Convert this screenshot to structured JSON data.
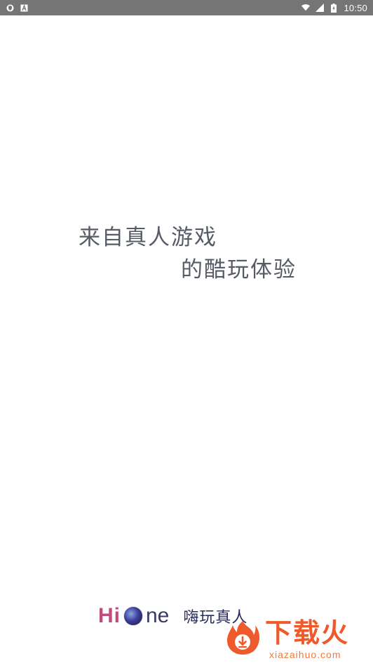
{
  "status_bar": {
    "time": "10:50",
    "icons": [
      "shield-icon",
      "font-a-icon",
      "wifi-icon",
      "cellular-signal-icon",
      "battery-charging-icon"
    ],
    "background": "#757575"
  },
  "splash": {
    "tagline_line1": "来自真人游戏",
    "tagline_line2": "的酷玩体验",
    "text_color": "#575b66"
  },
  "brand": {
    "hi": "Hi",
    "ne": "ne",
    "cn": "嗨玩真人"
  },
  "watermark": {
    "title": "下载火",
    "url": "xiazaihuo.com",
    "color": "#ef5a2a"
  }
}
